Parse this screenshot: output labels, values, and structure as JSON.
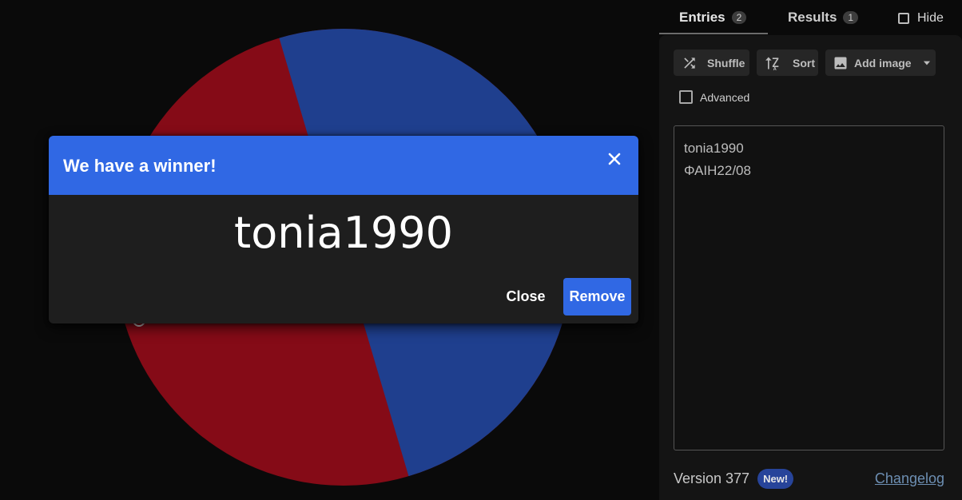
{
  "tabs": [
    {
      "label": "Entries",
      "count": "2"
    },
    {
      "label": "Results",
      "count": "1"
    }
  ],
  "hide_label": "Hide",
  "toolbar": {
    "shuffle_label": "Shuffle",
    "sort_label": "Sort",
    "add_image_label": "Add image"
  },
  "advanced_label": "Advanced",
  "entries": [
    "tonia1990",
    "ΦΑΙΗ22/08"
  ],
  "footer": {
    "version": "Version 377",
    "new_badge": "New!",
    "changelog": "Changelog"
  },
  "dialog": {
    "title": "We have a winner!",
    "winner": "tonia1990",
    "close_label": "Close",
    "remove_label": "Remove"
  },
  "colors": {
    "wheel_red": "#850b17",
    "wheel_blue": "#1f3f8e",
    "accent": "#3068e4",
    "background": "#0a0a0a"
  },
  "icons": {
    "shuffle": "shuffle-icon",
    "sort": "sort-icon",
    "add_image": "image-icon",
    "dropdown": "caret-down-icon",
    "close": "close-icon"
  }
}
